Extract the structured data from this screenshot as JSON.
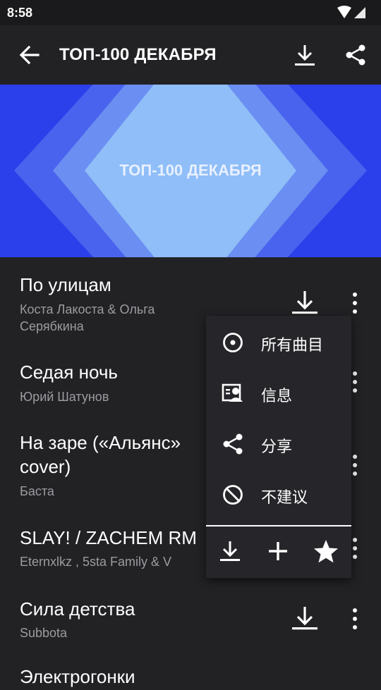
{
  "status_bar": {
    "time": "8:58"
  },
  "toolbar": {
    "title": "ТОП-100 ДЕКАБРЯ"
  },
  "banner": {
    "text": "ТОП-100 ДЕКАБРЯ"
  },
  "tracks": [
    {
      "title": "По улицам",
      "artist": "Коста Лакоста  &  Ольга Серябкина"
    },
    {
      "title": "Седая ночь",
      "artist": "Юрий Шатунов"
    },
    {
      "title": "На заре («Альянс» cover)",
      "artist": "Баста"
    },
    {
      "title": "SLAY! / ZACHEM RM",
      "artist": "Eternxlkz ,  5sta Family  &  V"
    },
    {
      "title": "Сила детства",
      "artist": "Subbota"
    },
    {
      "title": "Электрогонки",
      "artist": ""
    }
  ],
  "context_menu": {
    "items": [
      {
        "label": "所有曲目",
        "icon": "disc-icon"
      },
      {
        "label": "信息",
        "icon": "info-card-icon"
      },
      {
        "label": "分享",
        "icon": "share-icon"
      },
      {
        "label": "不建议",
        "icon": "block-icon"
      }
    ],
    "actions": [
      "download-icon",
      "add-icon",
      "star-icon"
    ]
  },
  "colors": {
    "background": "#222225",
    "banner_blue": "#2b3fea",
    "banner_light": "#8fbef8",
    "text_secondary": "#9b9ba0"
  }
}
